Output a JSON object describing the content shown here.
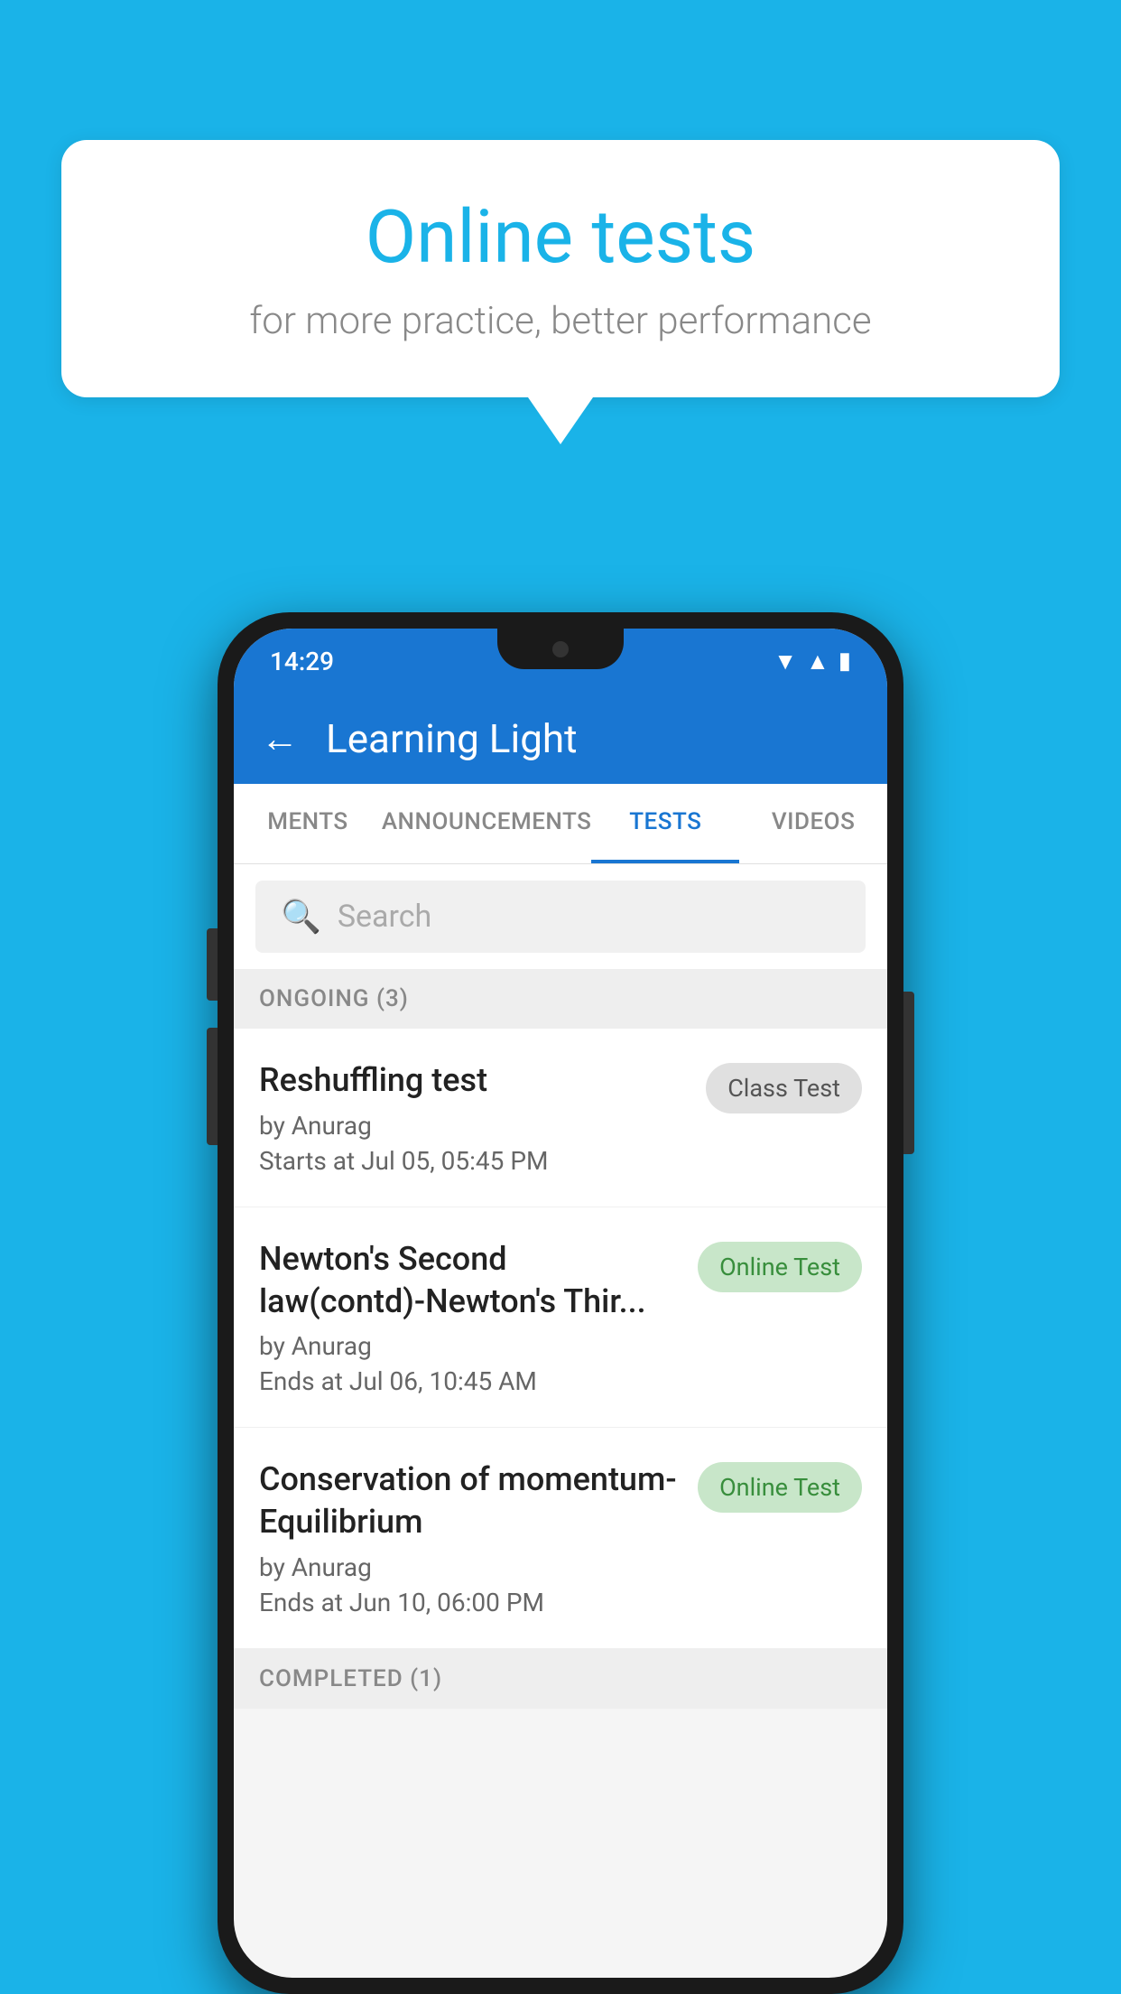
{
  "background_color": "#1ab3e8",
  "speech_bubble": {
    "title": "Online tests",
    "subtitle": "for more practice, better performance"
  },
  "phone": {
    "status_bar": {
      "time": "14:29",
      "icons": [
        "wifi",
        "signal",
        "battery"
      ]
    },
    "app_bar": {
      "back_label": "←",
      "title": "Learning Light"
    },
    "tabs": [
      {
        "label": "MENTS",
        "active": false
      },
      {
        "label": "ANNOUNCEMENTS",
        "active": false
      },
      {
        "label": "TESTS",
        "active": true
      },
      {
        "label": "VIDEOS",
        "active": false
      }
    ],
    "search": {
      "placeholder": "Search"
    },
    "sections": [
      {
        "header": "ONGOING (3)",
        "items": [
          {
            "title": "Reshuffling test",
            "by": "by Anurag",
            "time_label": "Starts at",
            "time": "Jul 05, 05:45 PM",
            "badge": "Class Test",
            "badge_type": "class"
          },
          {
            "title": "Newton's Second law(contd)-Newton's Thir...",
            "by": "by Anurag",
            "time_label": "Ends at",
            "time": "Jul 06, 10:45 AM",
            "badge": "Online Test",
            "badge_type": "online"
          },
          {
            "title": "Conservation of momentum-Equilibrium",
            "by": "by Anurag",
            "time_label": "Ends at",
            "time": "Jun 10, 06:00 PM",
            "badge": "Online Test",
            "badge_type": "online"
          }
        ]
      },
      {
        "header": "COMPLETED (1)",
        "items": []
      }
    ]
  }
}
